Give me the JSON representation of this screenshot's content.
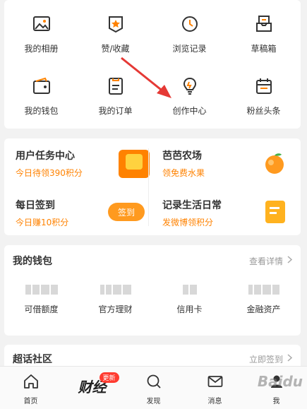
{
  "icon_grid": [
    {
      "label": "我的相册",
      "icon": "photo-album-icon"
    },
    {
      "label": "赞/收藏",
      "icon": "favorite-icon"
    },
    {
      "label": "浏览记录",
      "icon": "history-clock-icon"
    },
    {
      "label": "草稿箱",
      "icon": "drafts-tray-icon"
    },
    {
      "label": "我的钱包",
      "icon": "wallet-icon"
    },
    {
      "label": "我的订单",
      "icon": "order-list-icon"
    },
    {
      "label": "创作中心",
      "icon": "lightbulb-icon"
    },
    {
      "label": "粉丝头条",
      "icon": "calendar-icon"
    }
  ],
  "tasks": {
    "task_center": {
      "title": "用户任务中心",
      "sub": "今日待领390积分"
    },
    "farm": {
      "title": "芭芭农场",
      "sub": "领免费水果"
    },
    "checkin": {
      "title": "每日签到",
      "sub": "今日赚10积分",
      "button": "签到"
    },
    "record": {
      "title": "记录生活日常",
      "sub": "发微博领积分"
    }
  },
  "wallet": {
    "title": "我的钱包",
    "link": "查看详情",
    "items": [
      {
        "label": "可借额度"
      },
      {
        "label": "官方理财"
      },
      {
        "label": "信用卡"
      },
      {
        "label": "金融资产"
      }
    ]
  },
  "super": {
    "title": "超话社区",
    "link": "立即签到"
  },
  "tabbar": [
    {
      "label": "首页",
      "icon": "home-icon"
    },
    {
      "label": "财经",
      "icon": "finance-logo-icon",
      "badge": "更新"
    },
    {
      "label": "发现",
      "icon": "search-icon"
    },
    {
      "label": "消息",
      "icon": "mail-icon"
    },
    {
      "label": "我",
      "icon": "profile-icon"
    }
  ],
  "colors": {
    "accent": "#ff8200",
    "badge": "#ff3b30",
    "arrow": "#e53935"
  },
  "watermark": "Baidu"
}
